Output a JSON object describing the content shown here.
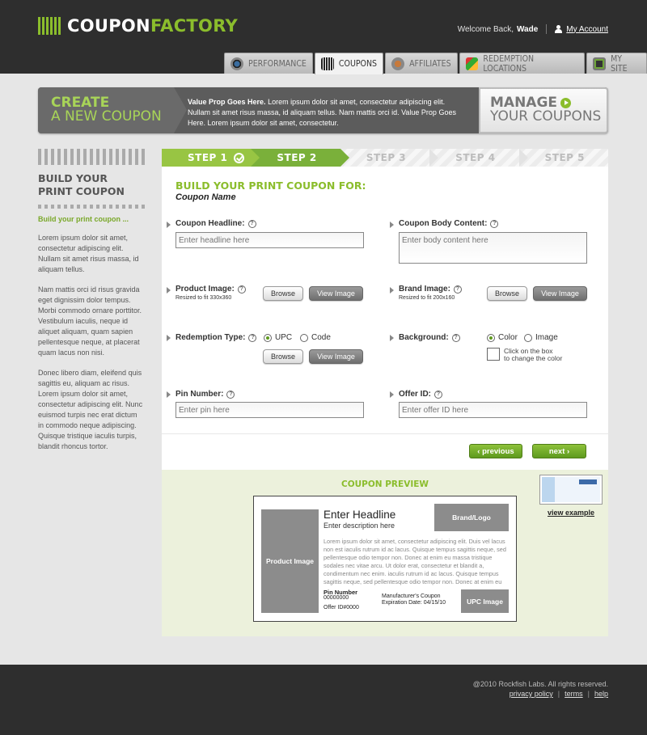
{
  "brand": {
    "part1": "COUPON",
    "part2": "FACTORY"
  },
  "user": {
    "welcome": "Welcome Back,",
    "name": "Wade",
    "account_link": "My Account"
  },
  "tabs": [
    {
      "label": "PERFORMANCE",
      "icon": "performance-icon"
    },
    {
      "label": "COUPONS",
      "icon": "coupons-barcode-icon",
      "active": true
    },
    {
      "label": "AFFILIATES",
      "icon": "affiliates-icon"
    },
    {
      "label": "REDEMPTION LOCATIONS",
      "icon": "redemption-map-icon"
    },
    {
      "label": "MY SITE",
      "icon": "my-site-monitor-icon"
    }
  ],
  "banner": {
    "create_l1": "CREATE",
    "create_l2": "A NEW COUPON",
    "value_prop_bold": "Value Prop Goes Here.",
    "value_prop_text": "Lorem ipsum dolor sit amet, consectetur adipiscing elit. Nullam sit amet risus massa, id aliquam tellus. Nam mattis orci id. Value Prop Goes Here. Lorem ipsum dolor sit amet, consectetur.",
    "manage_l1": "MANAGE",
    "manage_l2": "YOUR COUPONS"
  },
  "sidebar": {
    "title": "BUILD YOUR PRINT COUPON",
    "subtitle": "Build your print coupon ...",
    "p1": "Lorem ipsum dolor sit amet, consectetur adipiscing elit. Nullam sit amet risus massa, id aliquam tellus.",
    "p2": "Nam mattis orci id risus gravida eget dignissim dolor tempus. Morbi commodo ornare porttitor. Vestibulum iaculis, neque id aliquet aliquam, quam sapien pellentesque neque, at placerat quam lacus non nisi.",
    "p3": "Donec libero diam, eleifend quis sagittis eu, aliquam ac risus. Lorem ipsum dolor sit amet, consectetur adipiscing elit. Nunc euismod turpis nec erat dictum in commodo neque adipiscing. Quisque tristique iaculis turpis, blandit rhoncus tortor."
  },
  "steps": [
    {
      "label": "STEP 1",
      "state": "done"
    },
    {
      "label": "STEP 2",
      "state": "current"
    },
    {
      "label": "STEP 3",
      "state": "todo"
    },
    {
      "label": "STEP 4",
      "state": "todo"
    },
    {
      "label": "STEP 5",
      "state": "todo"
    }
  ],
  "form": {
    "title": "BUILD YOUR PRINT COUPON FOR:",
    "coupon_name": "Coupon Name",
    "help": "?",
    "headline_label": "Coupon Headline:",
    "headline_placeholder": "Enter headline here",
    "body_label": "Coupon Body Content:",
    "body_placeholder": "Enter body content here",
    "product_image_label": "Product Image:",
    "product_image_hint": "Resized to fit 330x360",
    "brand_image_label": "Brand Image:",
    "brand_image_hint": "Resized to fit 200x160",
    "browse": "Browse",
    "view_image": "View Image",
    "redemption_label": "Redemption Type:",
    "redemption_upc": "UPC",
    "redemption_code": "Code",
    "redemption_selected": "UPC",
    "background_label": "Background:",
    "background_color": "Color",
    "background_image": "Image",
    "background_selected": "Color",
    "color_hint_l1": "Click on the box",
    "color_hint_l2": "to change the color",
    "pin_label": "Pin Number:",
    "pin_placeholder": "Enter pin here",
    "offer_label": "Offer ID:",
    "offer_placeholder": "Enter offer ID here",
    "previous": "‹ previous",
    "next": "next ›"
  },
  "preview": {
    "title": "COUPON PREVIEW",
    "product_image": "Product Image",
    "headline": "Enter Headline",
    "description": "Enter description here",
    "brand_logo": "Brand/Logo",
    "body": "Lorem ipsum dolor sit amet, consectetur adipiscing elit. Duis vel lacus non est iaculis rutrum id ac lacus. Quisque tempus sagittis neque, sed pellentesque odio tempor non. Donec at enim eu massa tristique sodales nec vitae arcu. Ut dolor erat, consectetur et blandit a, condimentum nec enim. iaculis rutrum id ac lacus. Quisque tempus sagittis neque, sed pellentesque odio tempor non. Donec at enim eu massa tristique sodales nec vitae arcu. Ut",
    "pin_label": "Pin Number",
    "pin_value": "00000000",
    "offer_id": "Offer ID#0000",
    "manufacturer": "Manufacturer's Coupon",
    "expiration": "Expiration Date: 04/15/10",
    "upc": "UPC Image",
    "example_link": "view example"
  },
  "footer": {
    "copyright": "@2010 Rockfish Labs. All rights reserved.",
    "privacy": "privacy policy",
    "terms": "terms",
    "help": "help"
  },
  "colors": {
    "accent_green": "#8bbd2c",
    "header_bg": "#2e2e2e",
    "preview_bg": "#ecf1dc"
  }
}
